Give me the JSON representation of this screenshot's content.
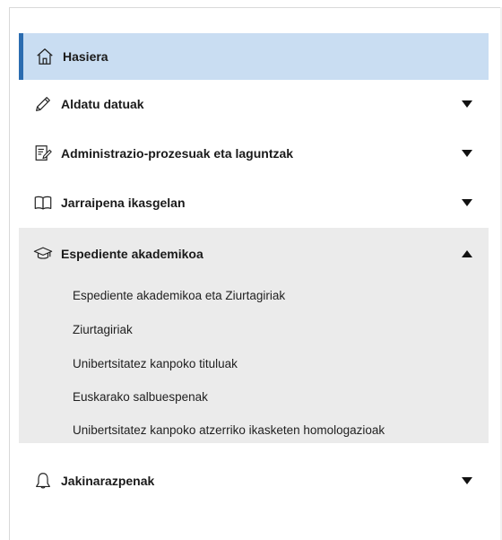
{
  "menu": {
    "home": {
      "label": "Hasiera",
      "icon": "home-icon",
      "active": true
    },
    "items": [
      {
        "label": "Aldatu datuak",
        "icon": "pencil-icon",
        "expanded": false
      },
      {
        "label": "Administrazio-prozesuak eta laguntzak",
        "icon": "form-edit-icon",
        "expanded": false
      },
      {
        "label": "Jarraipena ikasgelan",
        "icon": "book-icon",
        "expanded": false
      },
      {
        "label": "Espediente akademikoa",
        "icon": "graduation-cap-icon",
        "expanded": true,
        "children": [
          "Espediente akademikoa eta Ziurtagiriak",
          "Ziurtagiriak",
          "Unibertsitatez kanpoko tituluak",
          "Euskarako salbuespenak",
          "Unibertsitatez kanpoko atzerriko ikasketen homologazioak"
        ]
      },
      {
        "label": "Jakinarazpenak",
        "icon": "bell-icon",
        "expanded": false
      }
    ]
  },
  "colors": {
    "active_bg": "#c9ddf2",
    "active_border": "#2b6cb0",
    "expanded_bg": "#ebebeb",
    "text": "#1a1a1a"
  }
}
